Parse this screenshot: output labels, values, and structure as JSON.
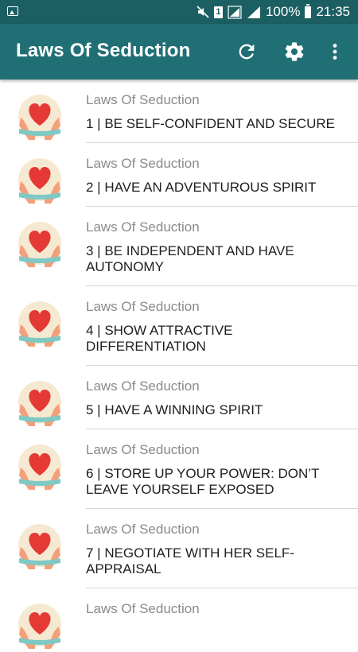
{
  "status_bar": {
    "battery": "100%",
    "time": "21:35",
    "sim_slot": "1"
  },
  "app_bar": {
    "title": "Laws Of Seduction",
    "actions": [
      "refresh-icon",
      "gear-icon",
      "more-vert-icon"
    ]
  },
  "colors": {
    "status_bar": "#1c5f63",
    "app_bar": "#206f75",
    "heart": "#e53935",
    "hands": "#f2a07b",
    "ribbon": "#7fc9c4"
  },
  "items": [
    {
      "subtitle": "Laws Of Seduction",
      "title": "1 | BE SELF-CONFIDENT AND SECURE"
    },
    {
      "subtitle": "Laws Of Seduction",
      "title": "2 | HAVE AN ADVENTUROUS SPIRIT"
    },
    {
      "subtitle": "Laws Of Seduction",
      "title": "3 | BE INDEPENDENT AND HAVE AUTONOMY"
    },
    {
      "subtitle": "Laws Of Seduction",
      "title": "4 | SHOW ATTRACTIVE DIFFERENTIATION"
    },
    {
      "subtitle": "Laws Of Seduction",
      "title": "5 | HAVE A WINNING SPIRIT"
    },
    {
      "subtitle": "Laws Of Seduction",
      "title": "6 | STORE UP YOUR POWER: DON’T LEAVE YOURSELF EXPOSED"
    },
    {
      "subtitle": "Laws Of Seduction",
      "title": "7 | NEGOTIATE WITH HER SELF-APPRAISAL"
    },
    {
      "subtitle": "Laws Of Seduction",
      "title": ""
    }
  ]
}
